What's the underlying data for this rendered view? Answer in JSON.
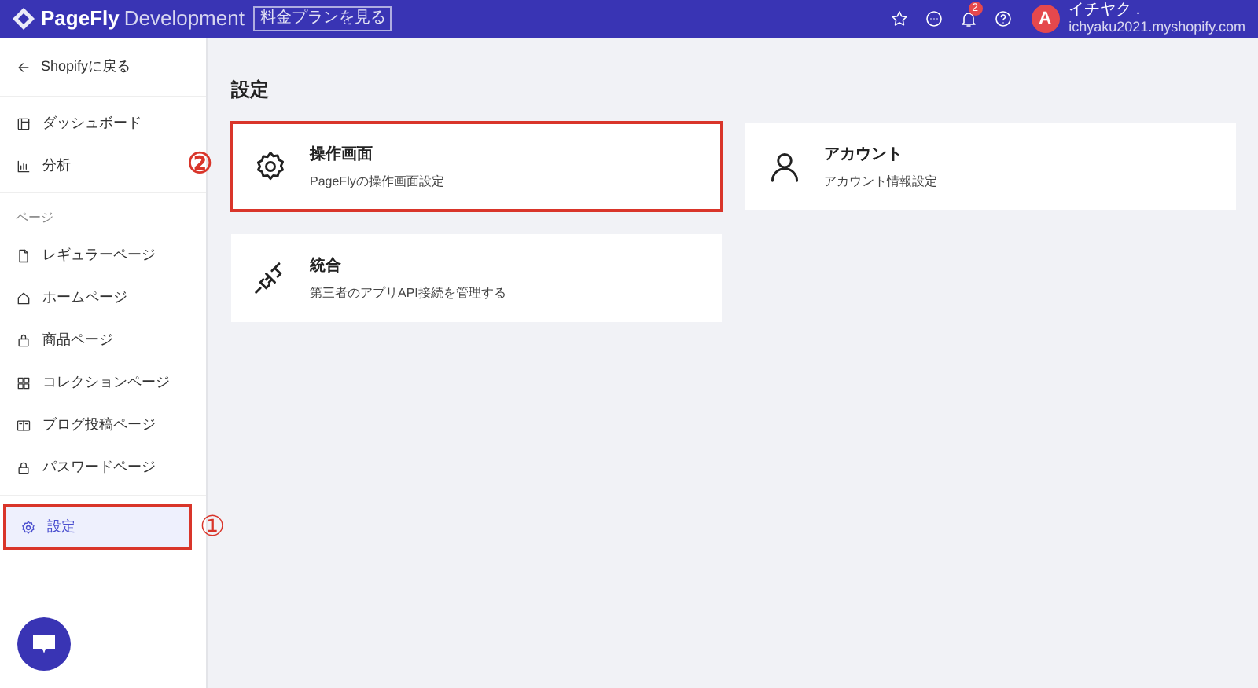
{
  "header": {
    "brand": "PageFly",
    "edition": "Development",
    "plan_button": "料金プランを見る",
    "notification_count": "2",
    "avatar": "A",
    "user_name": "イチヤク .",
    "shop_domain": "ichyaku2021.myshopify.com"
  },
  "sidebar": {
    "back_link": "Shopifyに戻る",
    "top_items": [
      {
        "kind": "dashboard",
        "label": "ダッシュボード",
        "selected": false,
        "highlighted": false
      },
      {
        "kind": "chart",
        "label": "分析",
        "selected": false,
        "highlighted": false
      }
    ],
    "section_label": "ページ",
    "page_items": [
      {
        "kind": "file",
        "label": "レギュラーページ",
        "selected": false,
        "highlighted": false
      },
      {
        "kind": "home",
        "label": "ホームページ",
        "selected": false,
        "highlighted": false
      },
      {
        "kind": "bag",
        "label": "商品ページ",
        "selected": false,
        "highlighted": false
      },
      {
        "kind": "grid",
        "label": "コレクションページ",
        "selected": false,
        "highlighted": false
      },
      {
        "kind": "book",
        "label": "ブログ投稿ページ",
        "selected": false,
        "highlighted": false
      },
      {
        "kind": "lock",
        "label": "パスワードページ",
        "selected": false,
        "highlighted": false
      }
    ],
    "bottom_items": [
      {
        "kind": "gear",
        "label": "設定",
        "selected": true,
        "highlighted": true,
        "marker": "①"
      }
    ]
  },
  "page_title": "設定",
  "cards": [
    {
      "kind": "gear",
      "title": "操作画面",
      "description": "PageFlyの操作画面設定",
      "highlighted": true,
      "marker": "②"
    },
    {
      "kind": "person",
      "title": "アカウント",
      "description": "アカウント情報設定",
      "highlighted": false
    },
    {
      "kind": "plug",
      "title": "統合",
      "description": "第三者のアプリAPI接続を管理する",
      "highlighted": false
    }
  ]
}
